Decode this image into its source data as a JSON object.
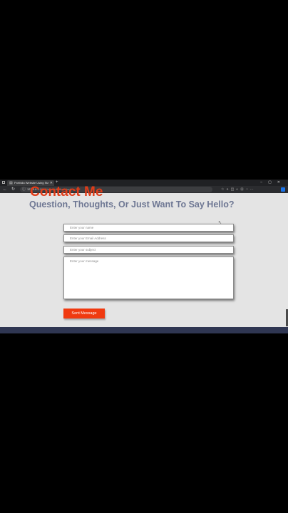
{
  "browser": {
    "tab_title": "Portfolio Website Using Stat",
    "url_domain": "127.0.0.1",
    "url_path": ":5500/index.html#contact",
    "newtab_label": "+",
    "tab_close": "✕",
    "window_controls": "–▢✕"
  },
  "page": {
    "title": "Contact Me",
    "subtitle": "Question, Thoughts, Or Just Want To Say Hello?"
  },
  "form": {
    "name_placeholder": "Enter your name",
    "email_placeholder": "Enter your Email Address",
    "subject_placeholder": "Enter your subject",
    "message_placeholder": "Enter your message",
    "send_label": "Sent Message"
  },
  "colors": {
    "accent": "#f03a10",
    "subtitle": "#6e7793",
    "footer": "#2f3652"
  },
  "icons": [
    "back-icon",
    "forward-icon",
    "refresh-icon",
    "info-icon",
    "extension-icon"
  ]
}
